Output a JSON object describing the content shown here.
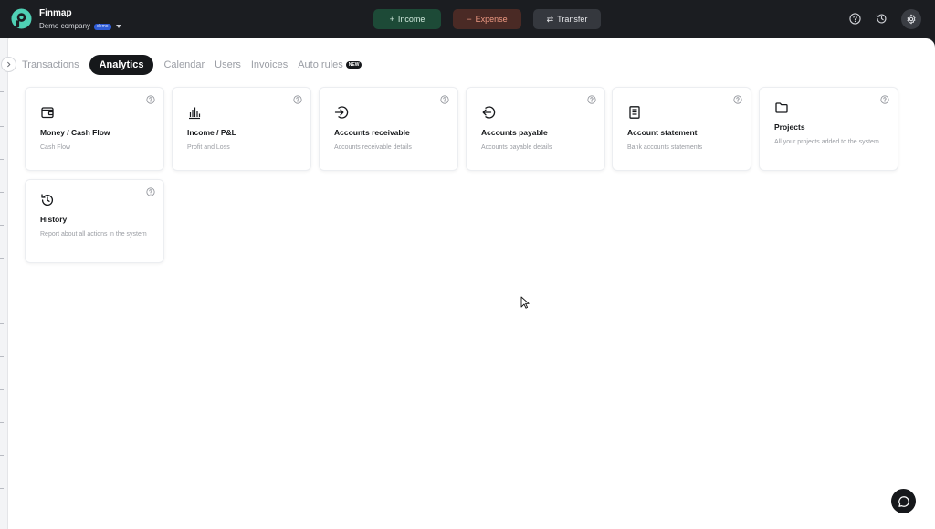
{
  "app": {
    "name": "Finmap",
    "company": "Demo company",
    "company_badge": "demo"
  },
  "toolbar": {
    "income_label": "Income",
    "expense_label": "Expense",
    "transfer_label": "Transfer"
  },
  "header_icons": [
    "help-icon",
    "history-icon",
    "settings-icon"
  ],
  "tabs": [
    {
      "label": "Transactions",
      "active": false
    },
    {
      "label": "Analytics",
      "active": true
    },
    {
      "label": "Calendar",
      "active": false
    },
    {
      "label": "Users",
      "active": false
    },
    {
      "label": "Invoices",
      "active": false
    },
    {
      "label": "Auto rules",
      "active": false,
      "badge": "NEW"
    }
  ],
  "cards": [
    {
      "title": "Money / Cash Flow",
      "description": "Cash Flow",
      "icon": "wallet-icon"
    },
    {
      "title": "Income / P&L",
      "description": "Profit and Loss",
      "icon": "bar-chart-icon"
    },
    {
      "title": "Accounts receivable",
      "description": "Accounts receivable details",
      "icon": "arrow-in-icon"
    },
    {
      "title": "Accounts payable",
      "description": "Accounts payable details",
      "icon": "arrow-out-icon"
    },
    {
      "title": "Account statement",
      "description": "Bank accounts statements",
      "icon": "document-icon"
    },
    {
      "title": "Projects",
      "description": "All your projects added to the system",
      "icon": "folder-icon"
    },
    {
      "title": "History",
      "description": "Report about all actions in the system",
      "icon": "history-icon"
    }
  ],
  "colors": {
    "topbar_bg": "#1b1d21",
    "income_bg": "#1d4a37",
    "expense_bg": "#4a2a25",
    "expense_text": "#ef9a83",
    "transfer_bg": "#35383e",
    "active_tab_bg": "#16181b",
    "logo_teal": "#4fd1b5"
  }
}
